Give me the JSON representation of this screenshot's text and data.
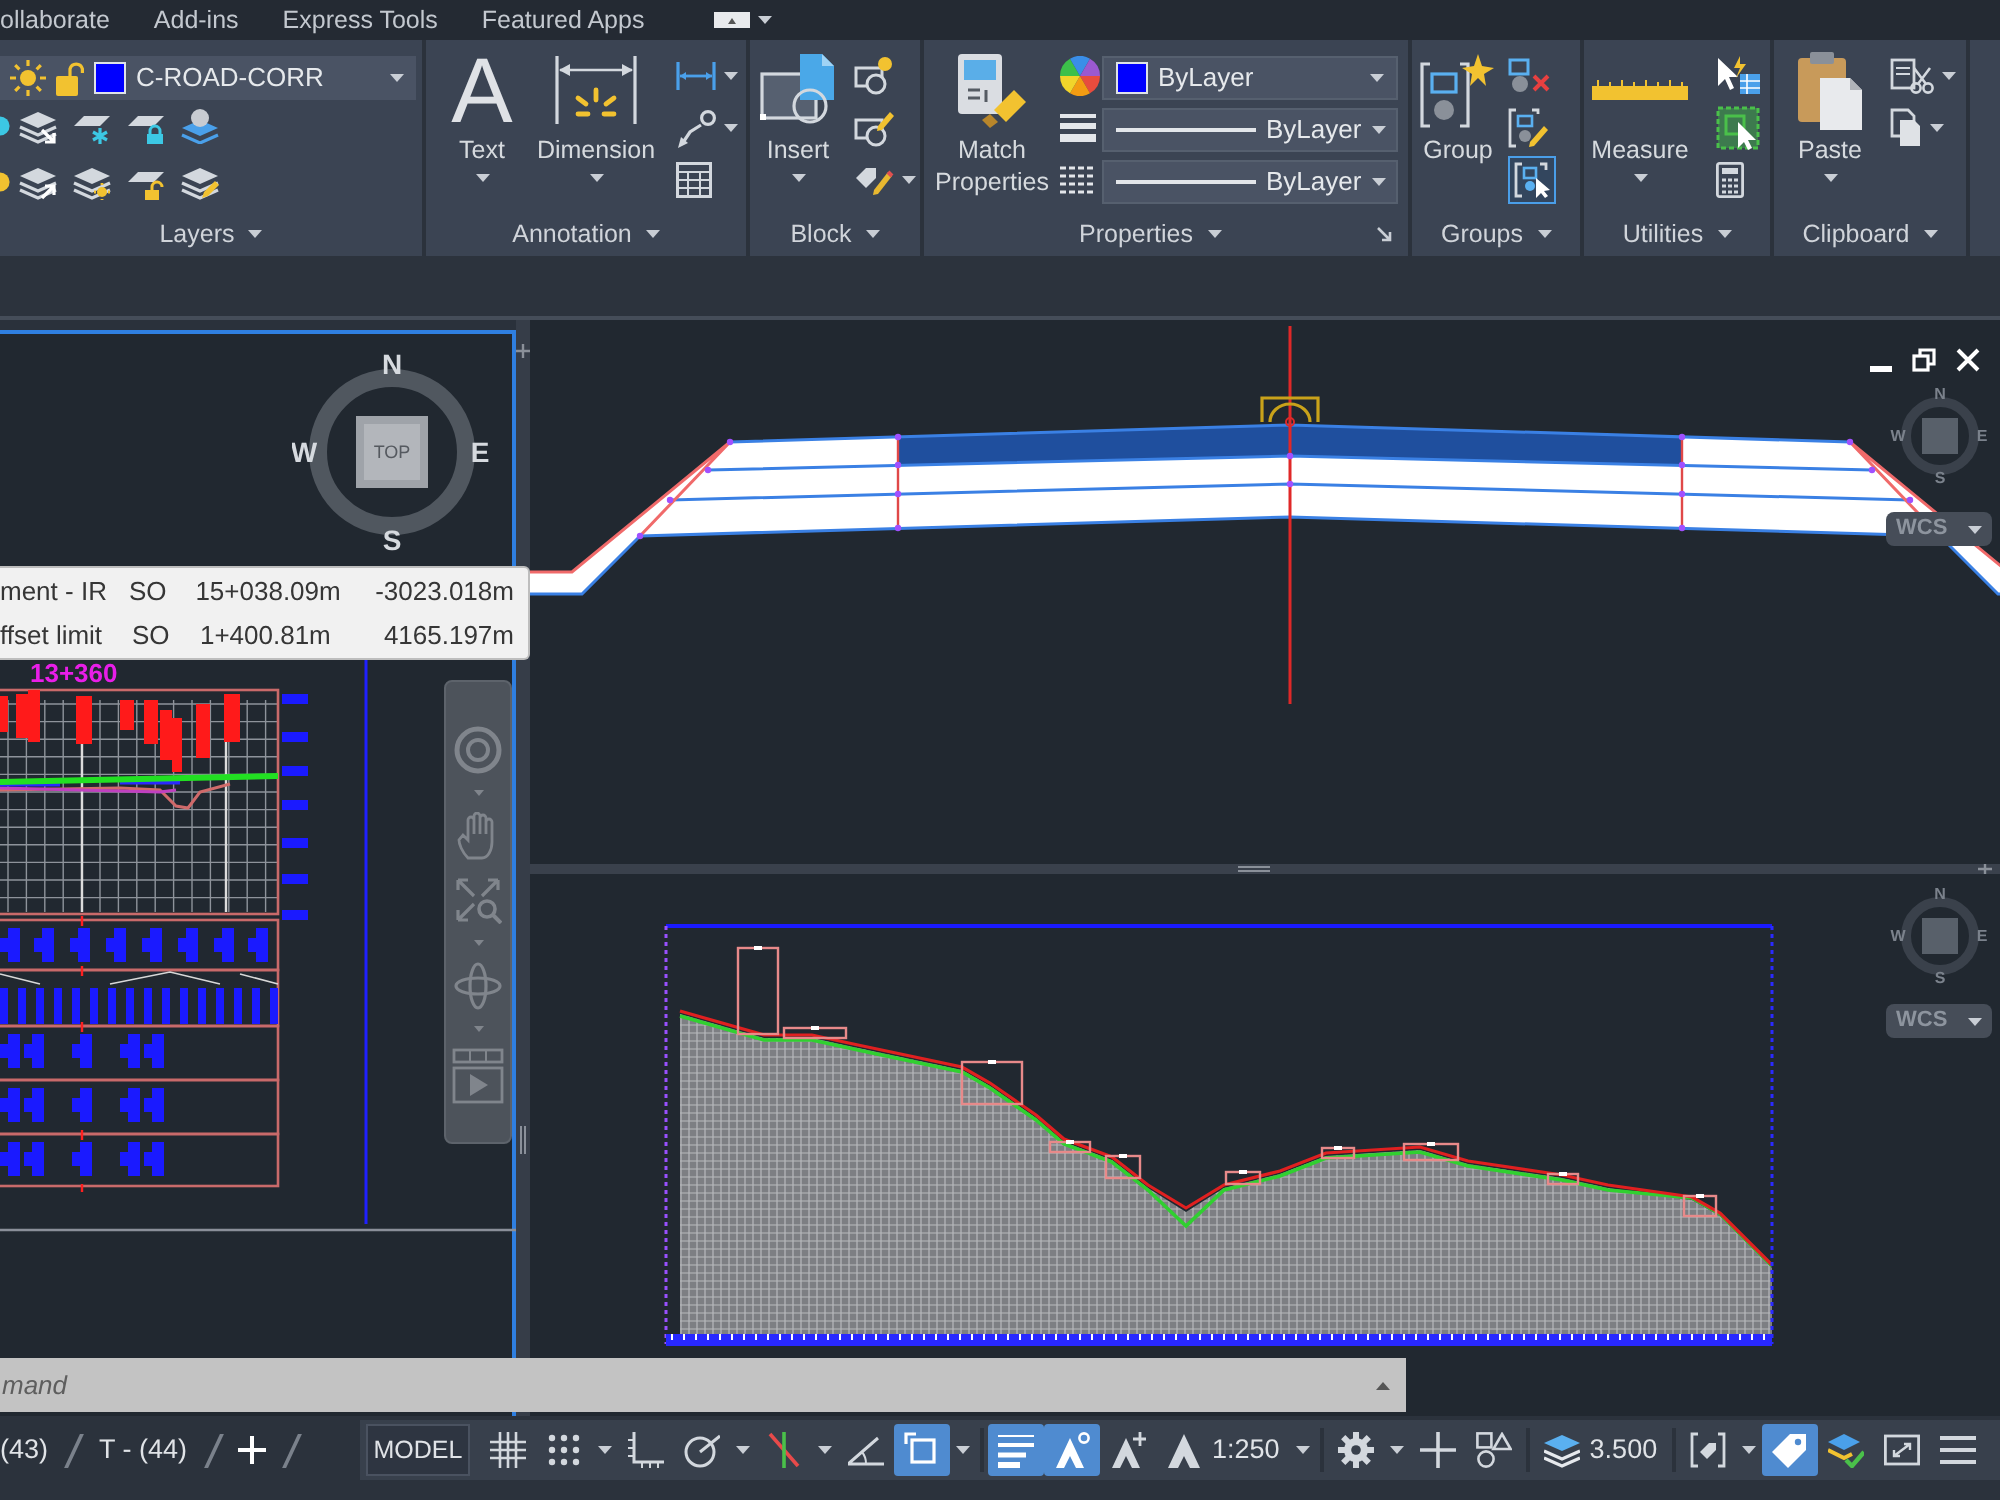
{
  "menu_tabs": [
    {
      "label": "ollaborate"
    },
    {
      "label": "Add-ins"
    },
    {
      "label": "Express Tools"
    },
    {
      "label": "Featured Apps"
    }
  ],
  "ribbon": {
    "layers": {
      "title": "Layers",
      "current_layer": {
        "label": "C-ROAD-CORR",
        "color": "#0000ff"
      }
    },
    "annotation": {
      "title": "Annotation",
      "text_button": {
        "icon": "A",
        "label": "Text"
      },
      "dimension_button": "Dimension"
    },
    "block": {
      "title": "Block",
      "insert_button": "Insert"
    },
    "properties": {
      "title": "Properties",
      "match_button": "Match Properties",
      "color_dropdown": {
        "label": "ByLayer",
        "color": "#0000ff"
      },
      "lineweight": "ByLayer",
      "linetype": "ByLayer"
    },
    "groups": {
      "title": "Groups",
      "group_button": "Group",
      "selection_on": true
    },
    "utilities": {
      "title": "Utilities",
      "measure_button": "Measure"
    },
    "clipboard": {
      "title": "Clipboard",
      "paste_button": "Paste"
    }
  },
  "viewports": {
    "left": {
      "active": true,
      "viewcube": {
        "north": "N",
        "west": "W",
        "east": "E",
        "south": "S",
        "face": "TOP"
      },
      "station_label": "13+360",
      "tooltip": {
        "rows": [
          [
            "ment - IR",
            "SO",
            "15+038.09m",
            "-3023.018m"
          ],
          [
            "ffset limit",
            "SO",
            "1+400.81m",
            "4165.197m"
          ]
        ]
      }
    },
    "section": {
      "active": false,
      "viewcube": {
        "north": "N",
        "west": "W",
        "east": "E",
        "south": "S",
        "ucs": "WCS"
      }
    },
    "profile": {
      "active": false,
      "viewcube": {
        "north": "N",
        "west": "W",
        "east": "E",
        "south": "S",
        "ucs": "WCS"
      }
    }
  },
  "command_line": {
    "placeholder": "mand"
  },
  "status_bar": {
    "layout_tabs": [
      {
        "label": "(43)"
      },
      {
        "label": "T - (44)"
      }
    ],
    "model_button": "MODEL",
    "tools": [
      {
        "kind": "grid",
        "on": false,
        "dropdown": false
      },
      {
        "kind": "snap",
        "on": false,
        "dropdown": true
      },
      {
        "kind": "ortho",
        "on": false,
        "dropdown": false
      },
      {
        "kind": "polar",
        "on": false,
        "dropdown": true
      },
      {
        "kind": "isodraft",
        "on": false,
        "dropdown": true
      },
      {
        "kind": "tracking",
        "on": false,
        "dropdown": false
      },
      {
        "kind": "osnap",
        "on": true,
        "dropdown": true
      },
      {
        "kind": "lineweight",
        "on": true,
        "dropdown": false
      },
      {
        "kind": "annovisibility",
        "on": true,
        "dropdown": false
      },
      {
        "kind": "autoscale",
        "on": false,
        "dropdown": false
      },
      {
        "kind": "annoscale",
        "on": false,
        "dropdown": true,
        "label": "1:250"
      },
      {
        "kind": "workspace",
        "on": false,
        "dropdown": true
      },
      {
        "kind": "monitor",
        "on": false,
        "dropdown": false
      },
      {
        "kind": "isolate",
        "on": false,
        "dropdown": false
      },
      {
        "kind": "elevation",
        "on": false,
        "dropdown": false,
        "label": "3.500"
      },
      {
        "kind": "selection",
        "on": false,
        "dropdown": true
      },
      {
        "kind": "tagging",
        "on": true,
        "dropdown": false
      },
      {
        "kind": "hardware",
        "on": false,
        "dropdown": false
      },
      {
        "kind": "fullscreen",
        "on": false,
        "dropdown": false
      },
      {
        "kind": "customize",
        "on": false,
        "dropdown": false
      }
    ]
  }
}
